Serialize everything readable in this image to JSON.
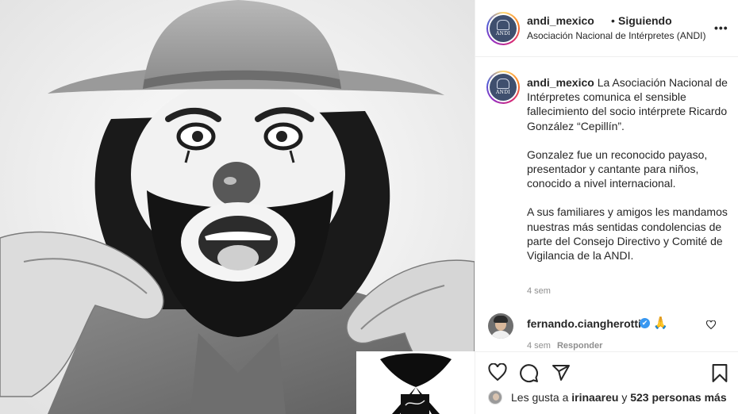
{
  "post": {
    "image_alt": "Cepillín clown portrait",
    "author": {
      "username": "andi_mexico",
      "separator": "•",
      "follow_status": "Siguiendo",
      "subtitle": "Asociación Nacional de Intérpretes (ANDI)",
      "logo_text": "ANDI"
    },
    "more_label": "•••",
    "caption": {
      "username": "andi_mexico",
      "paragraph_1": "La Asociación Nacional de Intérpretes comunica el sensible fallecimiento del socio intérprete Ricardo González “Cepillín”.",
      "paragraph_2": "Gonzalez fue un reconocido payaso, presentador y cantante para niños, conocido a nivel internacional.",
      "paragraph_3": "A sus familiares y amigos les mandamos nuestras más sentidas condolencias de parte del Consejo Directivo y Comité de Vigilancia de la ANDI.",
      "time": "4 sem"
    },
    "comments": [
      {
        "username": "fernando.ciangherotti",
        "verified_glyph": "✔",
        "text": "🙏",
        "time": "4 sem",
        "reply_label": "Responder"
      }
    ],
    "likes": {
      "prefix": "Les gusta a",
      "user": "irinaareu",
      "joiner": "y",
      "others": "523 personas más"
    },
    "icons": {
      "like": "heart-icon",
      "comment": "comment-bubble-icon",
      "share": "paper-plane-icon",
      "save": "bookmark-icon",
      "verified": "verified-badge-icon",
      "comment_like": "small-heart-icon"
    },
    "colors": {
      "text": "#262626",
      "muted": "#8e8e8e",
      "border": "#efefef",
      "verified": "#3897f0"
    }
  }
}
